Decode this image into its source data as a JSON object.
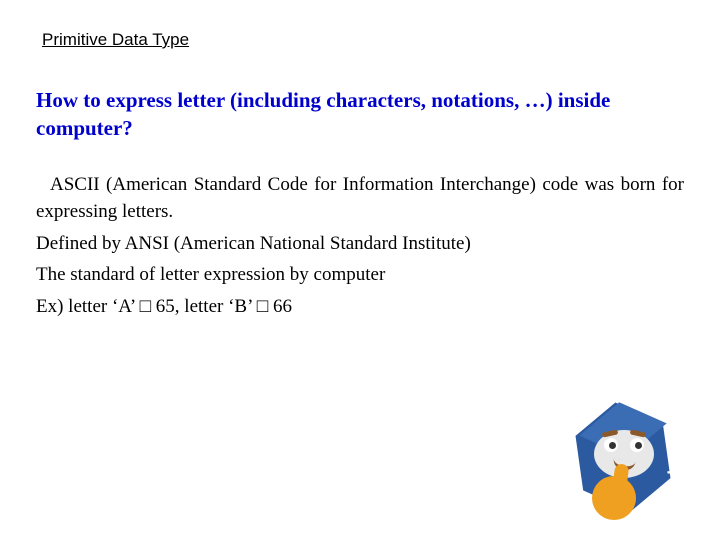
{
  "topic": "Primitive Data Type",
  "heading": "How to express letter (including characters, notations, …) inside computer?",
  "body": {
    "ascii_intro": "ASCII (American Standard Code for Information Interchange) code was born for expressing letters.",
    "defined_by": "Defined by ANSI (American National Standard Institute)",
    "standard": "The standard of letter expression by computer",
    "example": "Ex)  letter ‘A’ □ 65, letter ‘B’ □ 66"
  },
  "logo": {
    "label": "++",
    "name": "cpp-thinking-emoji-logo"
  }
}
